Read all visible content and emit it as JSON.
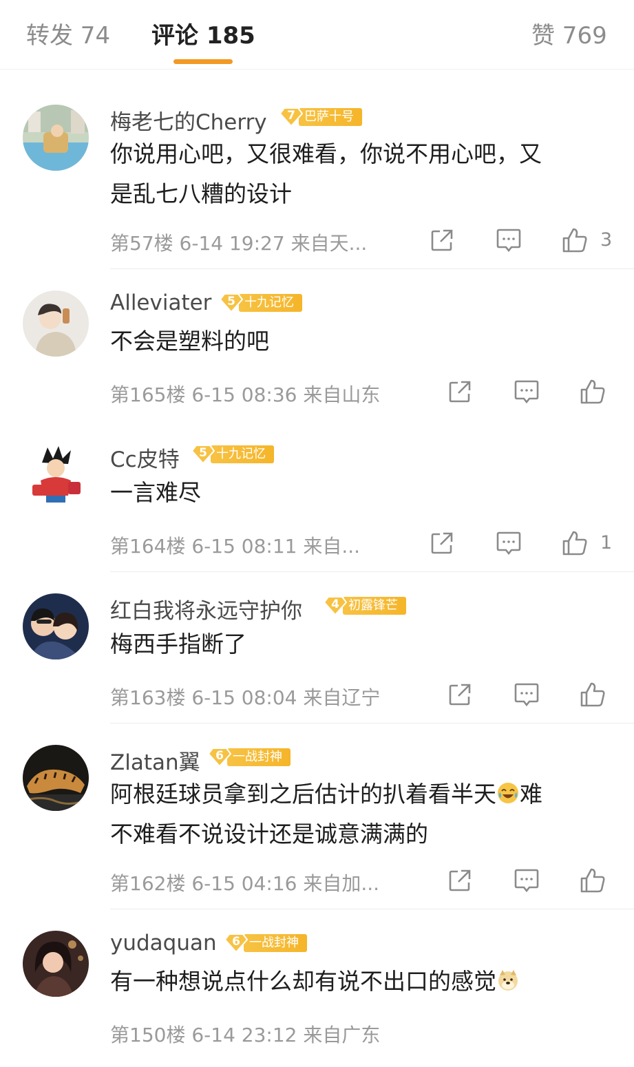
{
  "tabs": {
    "repost": "转发 74",
    "comments": "评论 185",
    "likes": "赞 769"
  },
  "comments": [
    {
      "username": "梅老七的Cherry",
      "badge_level": "7",
      "badge_name": "巴萨十号",
      "text_lines": [
        "你说用心吧，又很难看，你说不用心吧，又",
        "是乱七八糟的设计"
      ],
      "meta": "第57楼 6-14 19:27 来自天...",
      "likes": "3"
    },
    {
      "username": "Alleviater",
      "badge_level": "5",
      "badge_name": "十九记忆",
      "text_lines": [
        "不会是塑料的吧"
      ],
      "meta": "第165楼 6-15 08:36 来自山东",
      "likes": ""
    },
    {
      "username": "Cc皮特",
      "badge_level": "5",
      "badge_name": "十九记忆",
      "text_lines": [
        "一言难尽"
      ],
      "meta": "第164楼 6-15 08:11 来自...",
      "likes": "1"
    },
    {
      "username": "红白我将永远守护你",
      "badge_level": "4",
      "badge_name": "初露锋芒",
      "text_lines": [
        "梅西手指断了"
      ],
      "meta": "第163楼 6-15 08:04 来自辽宁",
      "likes": ""
    },
    {
      "username": "Zlatan翼",
      "badge_level": "6",
      "badge_name": "一战封神",
      "text_lines": [
        "阿根廷球员拿到之后估计的扒着看半天",
        "难",
        "不难看不说设计还是诚意满满的"
      ],
      "meta": "第162楼 6-15 04:16 来自加...",
      "likes": ""
    },
    {
      "username": "yudaquan",
      "badge_level": "6",
      "badge_name": "一战封神",
      "text_lines": [
        "有一种想说点什么却有说不出口的感觉"
      ],
      "meta": "第150楼 6-14 23:12 来自广东",
      "likes": ""
    }
  ],
  "icons": {
    "share": "share-icon",
    "comment": "comment-icon",
    "like": "thumbs-up-icon",
    "laugh_emoji": "laugh-cry-emoji-icon",
    "doge_emoji": "doge-emoji-icon"
  },
  "colors": {
    "accent": "#f29a24",
    "badge": "#f5b52a",
    "meta_text": "#9a9a9a"
  }
}
